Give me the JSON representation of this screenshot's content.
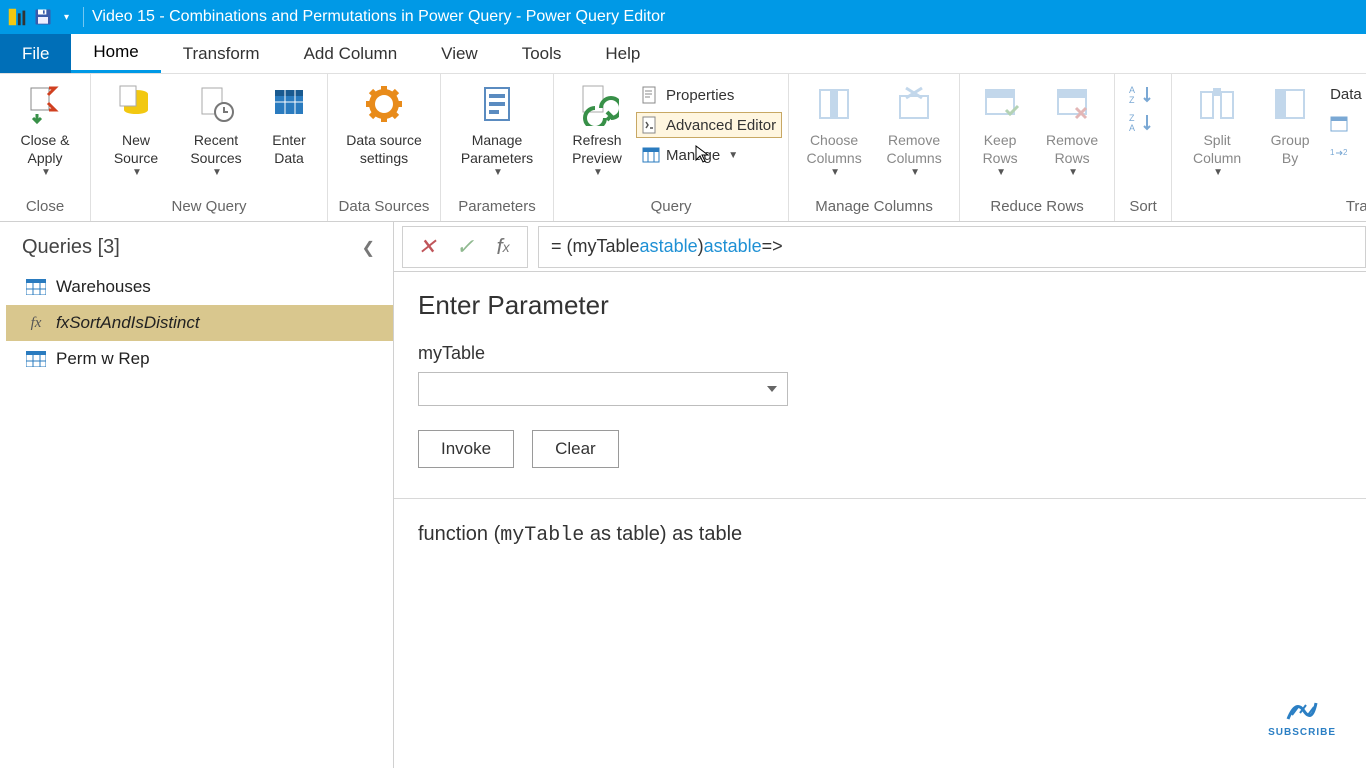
{
  "title": "Video 15 - Combinations and Permutations in Power Query - Power Query Editor",
  "tabs": {
    "file": "File",
    "home": "Home",
    "transform": "Transform",
    "addcol": "Add Column",
    "view": "View",
    "tools": "Tools",
    "help": "Help"
  },
  "ribbon": {
    "close": {
      "closeapply": "Close &\nApply",
      "group": "Close"
    },
    "newquery": {
      "newsource": "New\nSource",
      "recent": "Recent\nSources",
      "enterdata": "Enter\nData",
      "group": "New Query"
    },
    "datasources": {
      "settings": "Data source\nsettings",
      "group": "Data Sources"
    },
    "parameters": {
      "manage": "Manage\nParameters",
      "group": "Parameters"
    },
    "query": {
      "refresh": "Refresh\nPreview",
      "properties": "Properties",
      "adveditor": "Advanced Editor",
      "manage": "Manage",
      "group": "Query"
    },
    "managecols": {
      "choose": "Choose\nColumns",
      "remove": "Remove\nColumns",
      "group": "Manage Columns"
    },
    "reducerows": {
      "keep": "Keep\nRows",
      "remove": "Remove\nRows",
      "group": "Reduce Rows"
    },
    "sort": {
      "group": "Sort"
    },
    "transform2": {
      "split": "Split\nColumn",
      "groupby": "Group\nBy",
      "datatype": "Data",
      "group": "Tra"
    }
  },
  "queries": {
    "title": "Queries [3]",
    "items": [
      {
        "name": "Warehouses",
        "type": "table"
      },
      {
        "name": "fxSortAndIsDistinct",
        "type": "fx"
      },
      {
        "name": "Perm w Rep",
        "type": "table"
      }
    ]
  },
  "formula": {
    "eq": "= (",
    "id1": "myTable",
    "kw_as1": " as ",
    "kw_table1": "table",
    "mid": ") ",
    "kw_as2": "as ",
    "kw_table2": "table",
    "tail": " =>"
  },
  "enterparam": {
    "heading": "Enter Parameter",
    "param": "myTable",
    "invoke": "Invoke",
    "clear": "Clear"
  },
  "signature": {
    "pre": "function (",
    "arg": "myTable",
    "post": " as table) as table"
  },
  "subscribe": "SUBSCRIBE"
}
